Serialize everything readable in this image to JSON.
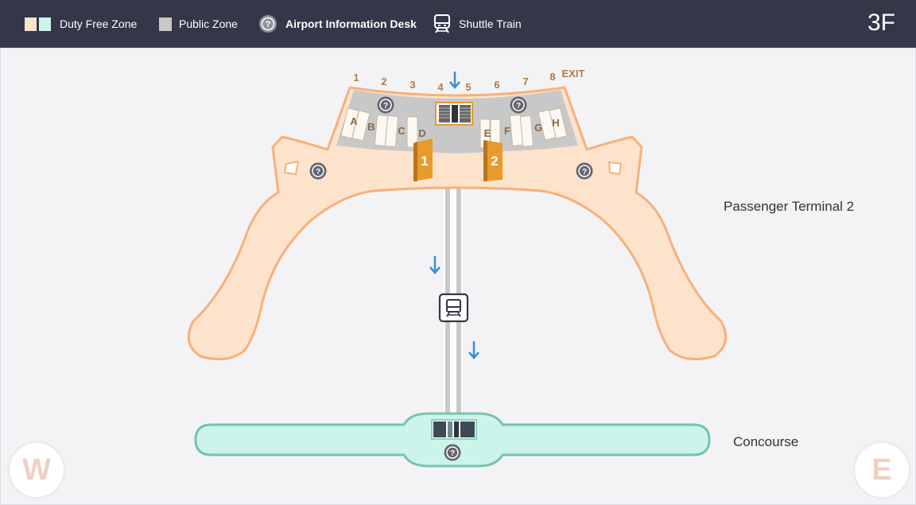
{
  "legend": {
    "duty_free": "Duty Free Zone",
    "public": "Public Zone",
    "info": "Airport Information Desk",
    "shuttle": "Shuttle Train"
  },
  "floor": "3F",
  "labels": {
    "terminal": "Passenger Terminal 2",
    "concourse": "Concourse"
  },
  "gates": [
    "1",
    "2",
    "3",
    "4",
    "5",
    "6",
    "7",
    "8"
  ],
  "exit": "EXIT",
  "counters": [
    "A",
    "B",
    "C",
    "D",
    "E",
    "F",
    "G",
    "H"
  ],
  "checkpoints": [
    "1",
    "2"
  ],
  "compass": {
    "west": "W",
    "east": "E"
  },
  "colors": {
    "duty_free_fill": "#fde3cc",
    "duty_free_stroke": "#f7b07a",
    "concourse_fill": "#ccf4ea",
    "concourse_stroke": "#79c2ad",
    "public_fill": "#c8c8c8",
    "topbar": "#333748",
    "checkpoint": "#e69b2c",
    "arrow": "#3a8fd0",
    "label_brown": "#b07c3f"
  }
}
